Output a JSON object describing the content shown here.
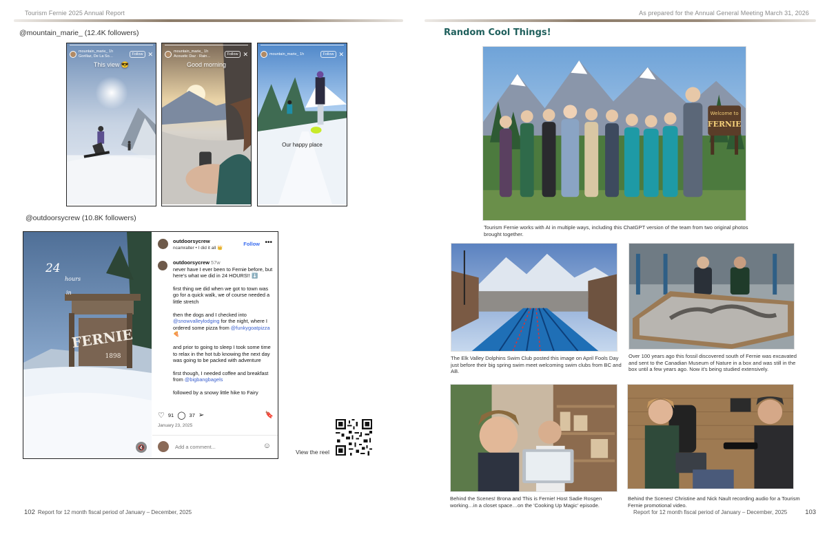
{
  "left_page": {
    "running_head": "Tourism Fernie 2025 Annual Report",
    "handle_1": "@mountain_marie_ (12.4K followers)",
    "stories": [
      {
        "user": "mountain_marie_",
        "time": "1h",
        "sub": "Gorillaz, De La So…",
        "follow": "Follow",
        "caption": "This view 😎"
      },
      {
        "user": "mountain_marie_",
        "time": "1h",
        "sub": "Acoustic Daz · Rain…",
        "follow": "Follow",
        "caption": "Good morning"
      },
      {
        "user": "mountain_marie_",
        "time": "1h",
        "sub": "",
        "follow": "Follow",
        "caption": "Our happy place"
      }
    ],
    "handle_2": "@outdoorsycrew (10.8K followers)",
    "reel": {
      "overlay_top": "24",
      "overlay_mid": "hours",
      "overlay_in": "in",
      "sign_text": "FERNIE",
      "sign_year": "1898",
      "user": "outdoorsycrew",
      "sub": "ncamralter • I did it all 👑",
      "follow": "Follow",
      "more": "•••",
      "comment_user": "outdoorsycrew",
      "comment_time": "57w",
      "p1": "never have I ever been to Fernie before, but here's what we did in 24 HOURS!! ⬇️",
      "p2": "first thing we did when we got to town was go for a quick walk, we of course needed a little stretch",
      "p3a": "then the dogs and I checked into ",
      "p3_link1": "@snowvalleylodging",
      "p3b": " for the night, where I ordered some pizza from ",
      "p3_link2": "@funkygoatpizza",
      "p3c": " 🍕",
      "p4": "and prior to going to sleep I took some time to relax in the hot tub knowing the next day was going to be packed with adventure",
      "p5a": "first though, I needed coffee and breakfast from ",
      "p5_link": "@bigbangbagels",
      "p6": "followed by a snowy little hike to Fairy",
      "likes": "91",
      "comments": "37",
      "date": "January 23, 2025",
      "add_comment": "Add a comment..."
    },
    "reel_label": "View the reel",
    "folio_num": "102",
    "folio_text": "Report for 12 month fiscal period of January – December, 2025"
  },
  "right_page": {
    "running_head": "As prepared for the Annual General Meeting March 31, 2026",
    "section_title": "Random Cool Things!",
    "team_sign_1": "Welcome to",
    "team_sign_2": "FERNIE",
    "team_caption": "Tourism Fernie works with AI in multiple ways, including this ChatGPT version of the team from two original photos brought together.",
    "pool_caption": "The Elk Valley Dolphins Swim Club posted this image on April Fools Day just before their big spring swim meet welcoming swim clubs from BC and AB.",
    "fossil_caption": "Over 100 years ago this fossil discovered south of Fernie was excavated and sent to the Canadian Museum of Nature in a box and was still in the box until a few years ago. Now it's being studied extensively.",
    "closet_caption": "Behind the Scenes!  Brona and This is Fernie! Host Sadie Rosgen working…in a closet space…on the 'Cooking Up Magic' episode.",
    "audio_caption": "Behind the Scenes!  Christine and Nick Nault recording audio for a Tourism Fernie promotional video.",
    "folio_text": "Report for 12 month fiscal period of January – December, 2025",
    "folio_num": "103"
  },
  "colors": {
    "section_title": "#1f5f5c",
    "link": "#3a5fcd",
    "follow": "#3a6df0",
    "rule": "#78644e"
  }
}
